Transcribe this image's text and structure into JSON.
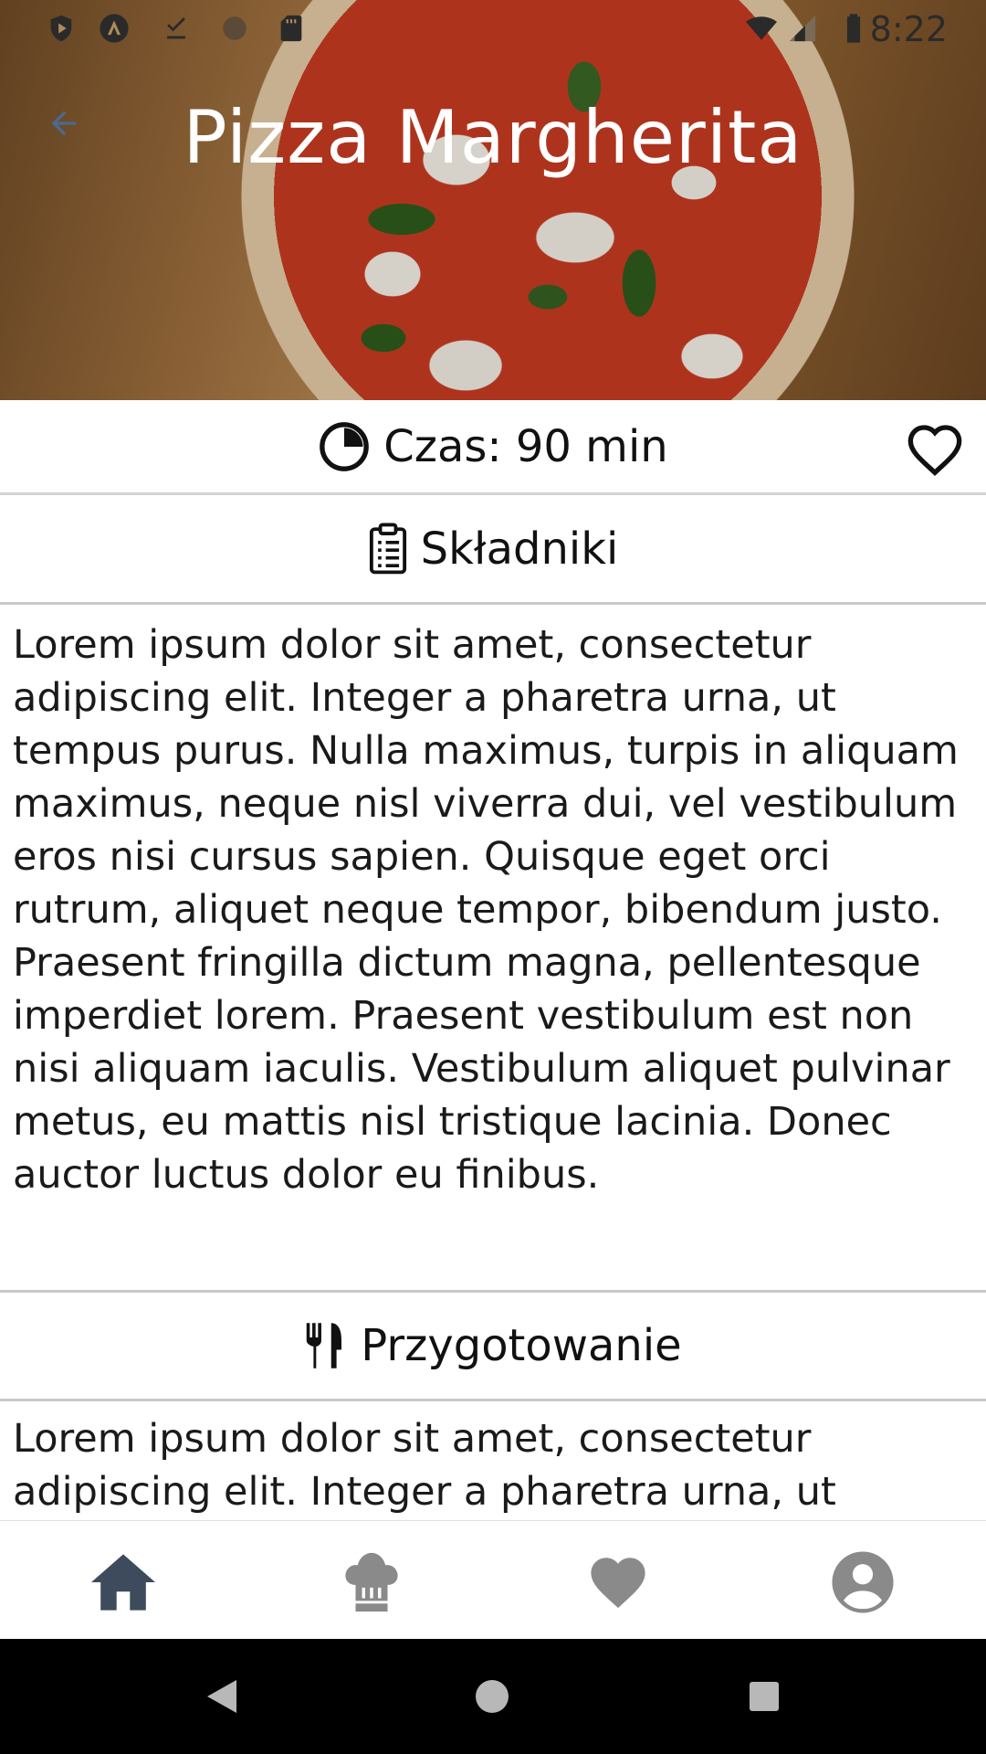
{
  "status_bar": {
    "time": "8:22"
  },
  "recipe": {
    "title": "Pizza Margherita",
    "time_text": "Czas: 90 min"
  },
  "sections": {
    "ingredients": {
      "title": "Składniki",
      "text": "Lorem ipsum dolor sit amet, consectetur adipiscing elit. Integer a pharetra urna, ut tempus purus. Nulla maximus, turpis in aliquam maximus, neque nisl viverra dui, vel vestibulum eros nisi cursus sapien. Quisque eget orci rutrum, aliquet neque tempor, bibendum justo. Praesent fringilla dictum magna, pellentesque imperdiet lorem. Praesent vestibulum est non nisi aliquam iaculis. Vestibulum aliquet pulvinar metus, eu mattis nisl tristique lacinia. Donec auctor luctus dolor eu finibus."
    },
    "preparation": {
      "title": "Przygotowanie",
      "text": "Lorem ipsum dolor sit amet, consectetur adipiscing elit. Integer a pharetra urna, ut"
    }
  },
  "bottom_nav": {
    "items": [
      {
        "icon": "home-icon",
        "active": true
      },
      {
        "icon": "chef-hat-icon",
        "active": false
      },
      {
        "icon": "heart-icon",
        "active": false
      },
      {
        "icon": "account-icon",
        "active": false
      }
    ]
  },
  "colors": {
    "nav_active": "#3d4b5c",
    "nav_inactive": "#8a8a8a",
    "divider": "#cfcfcf",
    "title": "#ffffff"
  }
}
